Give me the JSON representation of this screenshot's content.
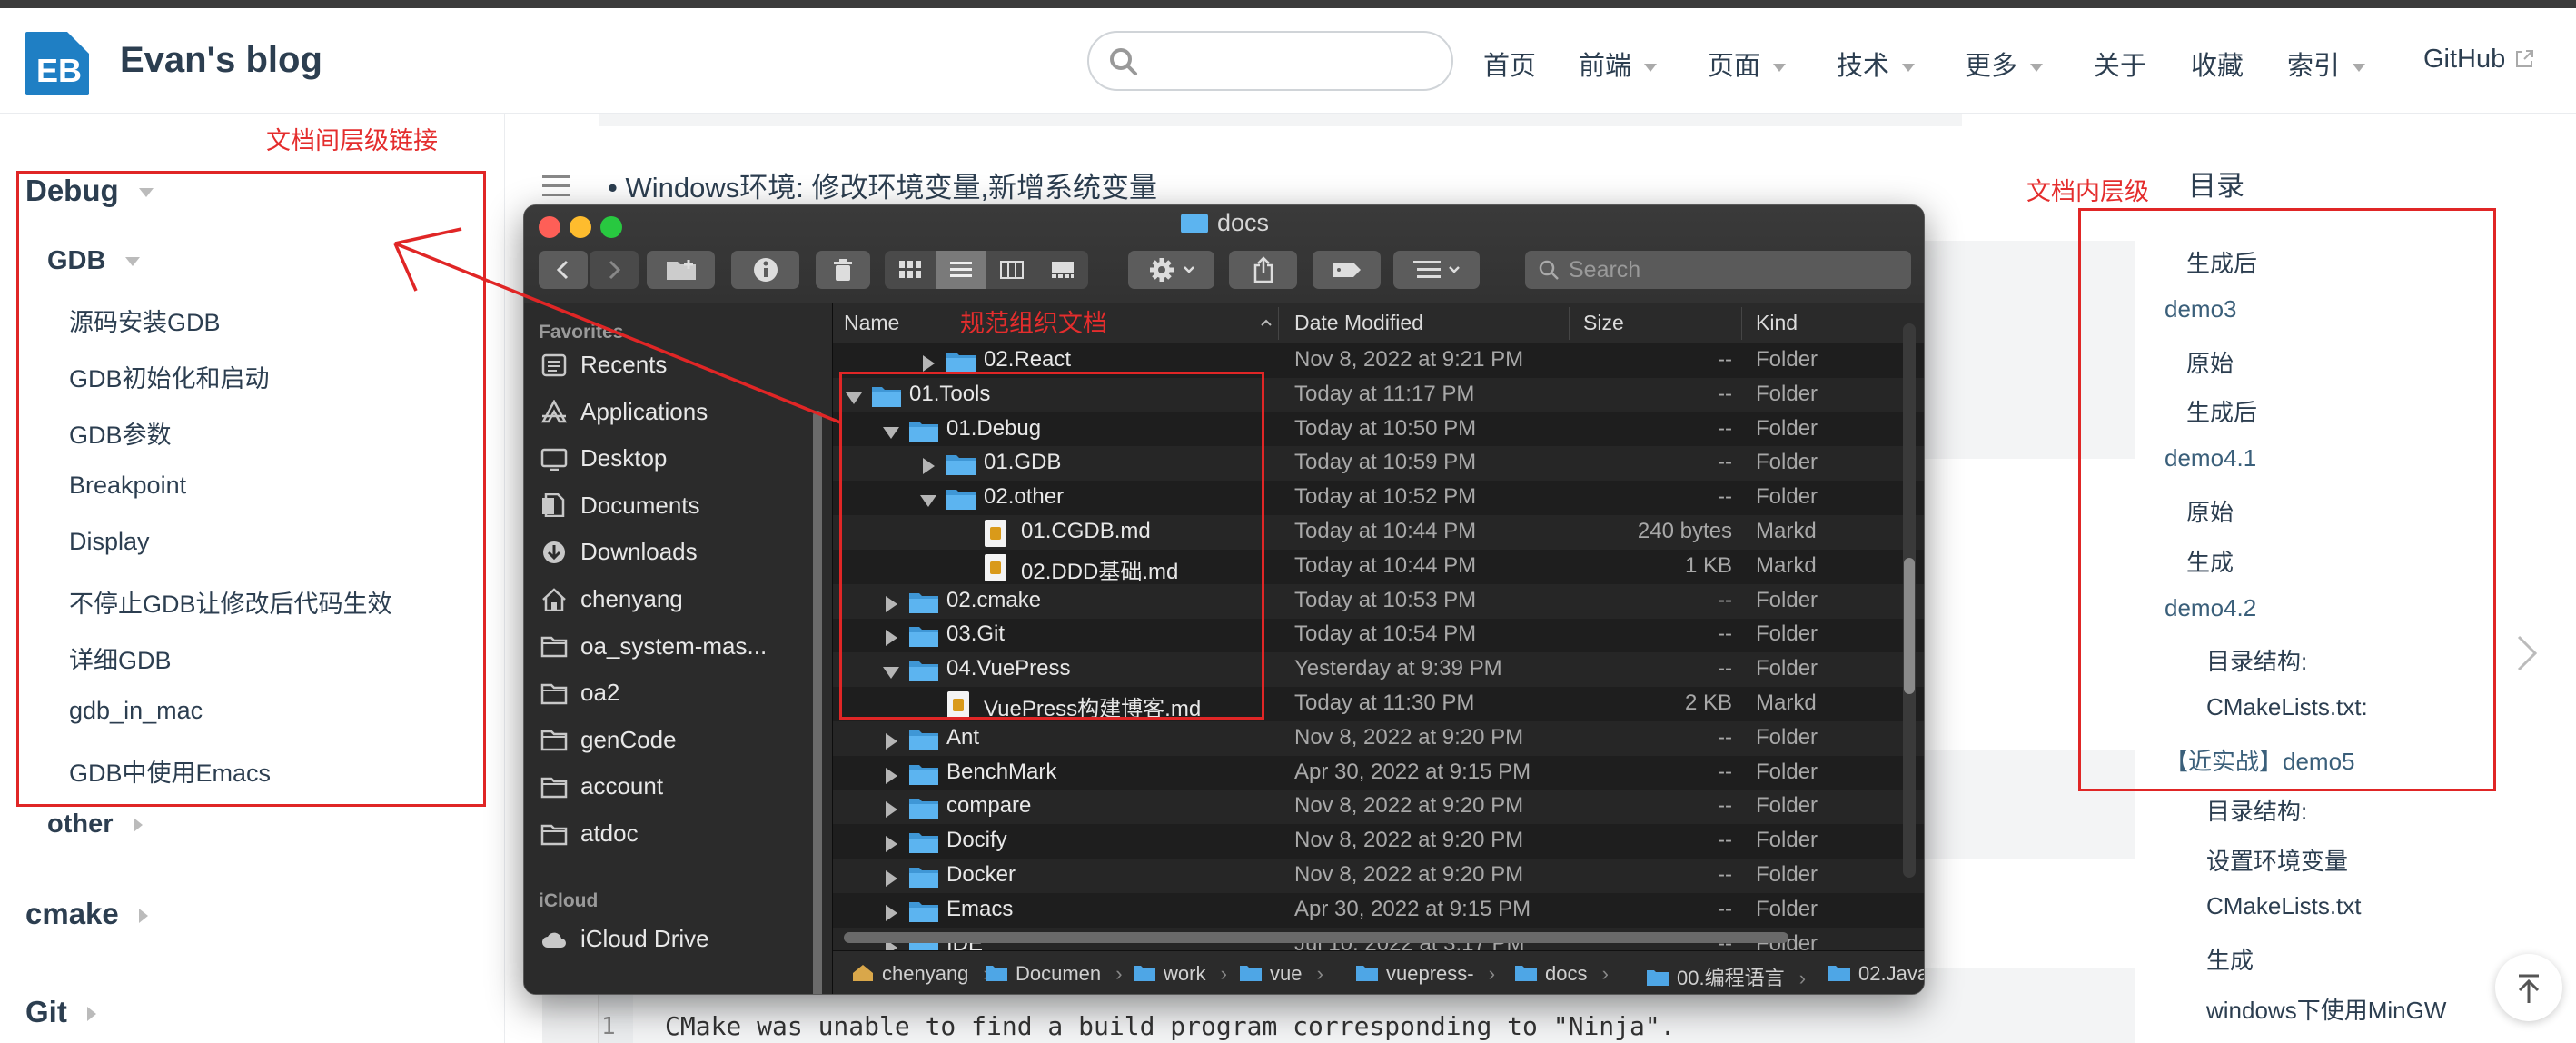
{
  "header": {
    "logo_text": "EB",
    "site_title": "Evan's blog",
    "search_placeholder": "",
    "nav": [
      {
        "label": "首页",
        "dropdown": false
      },
      {
        "label": "前端",
        "dropdown": true
      },
      {
        "label": "页面",
        "dropdown": true
      },
      {
        "label": "技术",
        "dropdown": true
      },
      {
        "label": "更多",
        "dropdown": true
      },
      {
        "label": "关于",
        "dropdown": false
      },
      {
        "label": "收藏",
        "dropdown": false
      },
      {
        "label": "索引",
        "dropdown": true
      },
      {
        "label": "GitHub",
        "dropdown": false,
        "external": true
      }
    ]
  },
  "annotations": {
    "left": "文档间层级链接",
    "right": "文档内层级",
    "middle": "规范组织文档",
    "color": "#e02626"
  },
  "sidebar": {
    "groups": [
      {
        "label": "Debug",
        "expanded": true
      },
      {
        "label": "GDB",
        "expanded": true
      }
    ],
    "items": [
      "源码安装GDB",
      "GDB初始化和启动",
      "GDB参数",
      "Breakpoint",
      "Display",
      "不停止GDB让修改后代码生效",
      "详细GDB",
      "gdb_in_mac",
      "GDB中使用Emacs"
    ],
    "more": [
      {
        "label": "other",
        "level": 2
      },
      {
        "label": "cmake",
        "level": 1
      },
      {
        "label": "Git",
        "level": 1
      }
    ]
  },
  "content": {
    "bullet_text": "Windows环境: 修改环境变量,新增系统变量",
    "code_line_number": "1",
    "code_line": "CMake was unable to find a build program corresponding to \"Ninja\"."
  },
  "toc": {
    "title": "目录",
    "items": [
      {
        "label": "生成后",
        "level": 2
      },
      {
        "label": "demo3",
        "level": 1
      },
      {
        "label": "原始",
        "level": 2
      },
      {
        "label": "生成后",
        "level": 2
      },
      {
        "label": "demo4.1",
        "level": 1
      },
      {
        "label": "原始",
        "level": 2
      },
      {
        "label": "生成",
        "level": 2
      },
      {
        "label": "demo4.2",
        "level": 1
      },
      {
        "label": "目录结构:",
        "level": 3
      },
      {
        "label": "CMakeLists.txt:",
        "level": 3
      },
      {
        "label": "【近实战】demo5",
        "level": 1
      },
      {
        "label": "目录结构:",
        "level": 3
      },
      {
        "label": "设置环境变量",
        "level": 3
      },
      {
        "label": "CMakeLists.txt",
        "level": 3
      },
      {
        "label": "生成",
        "level": 3
      },
      {
        "label": "windows下使用MinGW",
        "level": 3
      }
    ]
  },
  "finder": {
    "title": "docs",
    "search_placeholder": "Search",
    "sidebar": {
      "favorites_label": "Favorites",
      "favorites": [
        {
          "label": "Recents",
          "icon": "clock-icon"
        },
        {
          "label": "Applications",
          "icon": "applications-icon"
        },
        {
          "label": "Desktop",
          "icon": "desktop-icon"
        },
        {
          "label": "Documents",
          "icon": "document-icon"
        },
        {
          "label": "Downloads",
          "icon": "download-icon"
        },
        {
          "label": "chenyang",
          "icon": "home-icon"
        },
        {
          "label": "oa_system-mas...",
          "icon": "folder-icon"
        },
        {
          "label": "oa2",
          "icon": "folder-icon"
        },
        {
          "label": "genCode",
          "icon": "folder-icon"
        },
        {
          "label": "account",
          "icon": "folder-icon"
        },
        {
          "label": "atdoc",
          "icon": "folder-icon"
        }
      ],
      "icloud_label": "iCloud",
      "icloud": [
        {
          "label": "iCloud Drive",
          "icon": "cloud-icon"
        }
      ]
    },
    "columns": [
      "Name",
      "Date Modified",
      "Size",
      "Kind"
    ],
    "rows": [
      {
        "name": "02.React",
        "date": "Nov 8, 2022 at 9:21 PM",
        "size": "--",
        "kind": "Folder",
        "indent": 2,
        "disclosure": "closed",
        "type": "folder"
      },
      {
        "name": "01.Tools",
        "date": "Today at 11:17 PM",
        "size": "--",
        "kind": "Folder",
        "indent": 0,
        "disclosure": "open",
        "type": "folder"
      },
      {
        "name": "01.Debug",
        "date": "Today at 10:50 PM",
        "size": "--",
        "kind": "Folder",
        "indent": 1,
        "disclosure": "open",
        "type": "folder"
      },
      {
        "name": "01.GDB",
        "date": "Today at 10:59 PM",
        "size": "--",
        "kind": "Folder",
        "indent": 2,
        "disclosure": "closed",
        "type": "folder"
      },
      {
        "name": "02.other",
        "date": "Today at 10:52 PM",
        "size": "--",
        "kind": "Folder",
        "indent": 2,
        "disclosure": "open",
        "type": "folder"
      },
      {
        "name": "01.CGDB.md",
        "date": "Today at 10:44 PM",
        "size": "240 bytes",
        "kind": "Markd",
        "indent": 3,
        "disclosure": "none",
        "type": "md"
      },
      {
        "name": "02.DDD基础.md",
        "date": "Today at 10:44 PM",
        "size": "1 KB",
        "kind": "Markd",
        "indent": 3,
        "disclosure": "none",
        "type": "md"
      },
      {
        "name": "02.cmake",
        "date": "Today at 10:53 PM",
        "size": "--",
        "kind": "Folder",
        "indent": 1,
        "disclosure": "closed",
        "type": "folder"
      },
      {
        "name": "03.Git",
        "date": "Today at 10:54 PM",
        "size": "--",
        "kind": "Folder",
        "indent": 1,
        "disclosure": "closed",
        "type": "folder"
      },
      {
        "name": "04.VuePress",
        "date": "Yesterday at 9:39 PM",
        "size": "--",
        "kind": "Folder",
        "indent": 1,
        "disclosure": "open",
        "type": "folder"
      },
      {
        "name": "VuePress构建博客.md",
        "date": "Today at 11:30 PM",
        "size": "2 KB",
        "kind": "Markd",
        "indent": 2,
        "disclosure": "none",
        "type": "md"
      },
      {
        "name": "Ant",
        "date": "Nov 8, 2022 at 9:20 PM",
        "size": "--",
        "kind": "Folder",
        "indent": 1,
        "disclosure": "closed",
        "type": "folder"
      },
      {
        "name": "BenchMark",
        "date": "Apr 30, 2022 at 9:15 PM",
        "size": "--",
        "kind": "Folder",
        "indent": 1,
        "disclosure": "closed",
        "type": "folder"
      },
      {
        "name": "compare",
        "date": "Nov 8, 2022 at 9:20 PM",
        "size": "--",
        "kind": "Folder",
        "indent": 1,
        "disclosure": "closed",
        "type": "folder"
      },
      {
        "name": "Docify",
        "date": "Nov 8, 2022 at 9:20 PM",
        "size": "--",
        "kind": "Folder",
        "indent": 1,
        "disclosure": "closed",
        "type": "folder"
      },
      {
        "name": "Docker",
        "date": "Nov 8, 2022 at 9:20 PM",
        "size": "--",
        "kind": "Folder",
        "indent": 1,
        "disclosure": "closed",
        "type": "folder"
      },
      {
        "name": "Emacs",
        "date": "Apr 30, 2022 at 9:15 PM",
        "size": "--",
        "kind": "Folder",
        "indent": 1,
        "disclosure": "closed",
        "type": "folder"
      },
      {
        "name": "IDE",
        "date": "Jul 10, 2022 at 3:17 PM",
        "size": "--",
        "kind": "Folder",
        "indent": 1,
        "disclosure": "closed",
        "type": "folder"
      }
    ],
    "path": [
      "chenyang",
      "Documen",
      "work",
      "vue",
      "vuepress-",
      "docs",
      "00.编程语言",
      "02.Java"
    ]
  }
}
